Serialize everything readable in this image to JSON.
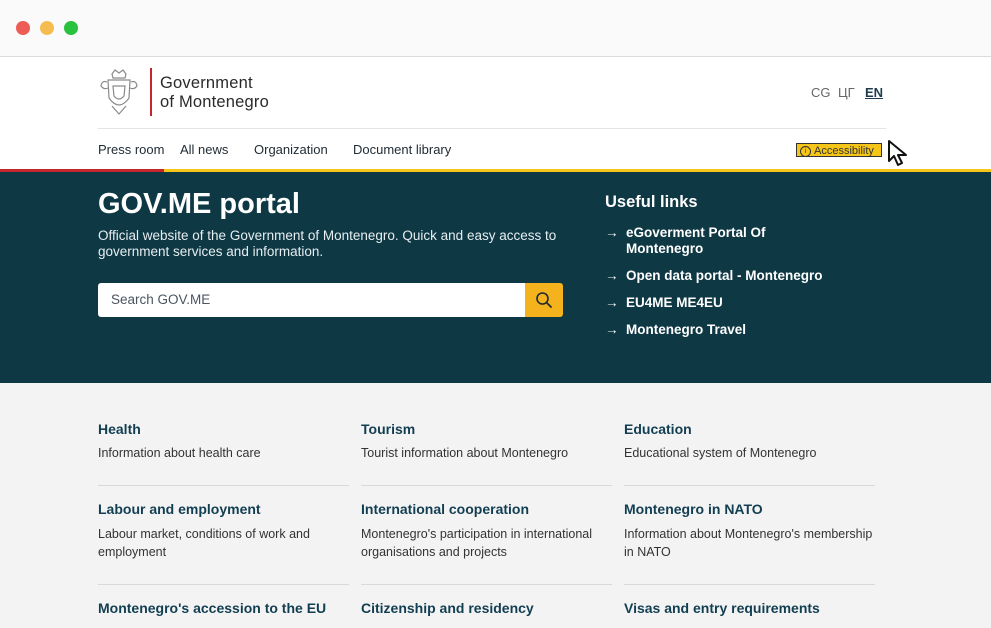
{
  "language_switch": [
    "CG",
    "ЦГ",
    "EN"
  ],
  "logo": {
    "line1": "Government",
    "line2": "of Montenegro"
  },
  "nav": [
    "Press room",
    "All news",
    "Organization",
    "Document library"
  ],
  "accessibility_label": "Accessibility",
  "hero": {
    "title": "GOV.ME portal",
    "description": "Official website of the Government of Montenegro. Quick and easy access to government services and information.",
    "search_placeholder": "Search GOV.ME"
  },
  "useful_links": {
    "title": "Useful links",
    "items": [
      "eGoverment Portal Of Montenegro",
      "Open data portal - Montenegro",
      "EU4ME ME4EU",
      "Montenegro Travel"
    ]
  },
  "cards": [
    {
      "title": "Health",
      "desc": "Information about health care"
    },
    {
      "title": "Tourism",
      "desc": "Tourist information about Montenegro"
    },
    {
      "title": "Education",
      "desc": "Educational system of Montenegro"
    },
    {
      "title": "Labour and employment",
      "desc": "Labour market, conditions of work and employment"
    },
    {
      "title": "International cooperation",
      "desc": "Montenegro's participation in international organisations and projects"
    },
    {
      "title": "Montenegro in NATO",
      "desc": "Information about Montenegro's membership in NATO"
    },
    {
      "title": "Montenegro's accession to the EU",
      "desc": ""
    },
    {
      "title": "Citizenship and residency",
      "desc": ""
    },
    {
      "title": "Visas and entry requirements",
      "desc": ""
    }
  ],
  "colors": {
    "hero_bg": "#0f3845",
    "accent_yellow": "#f5c518",
    "accent_red": "#c4262e",
    "link_title": "#123e52"
  }
}
